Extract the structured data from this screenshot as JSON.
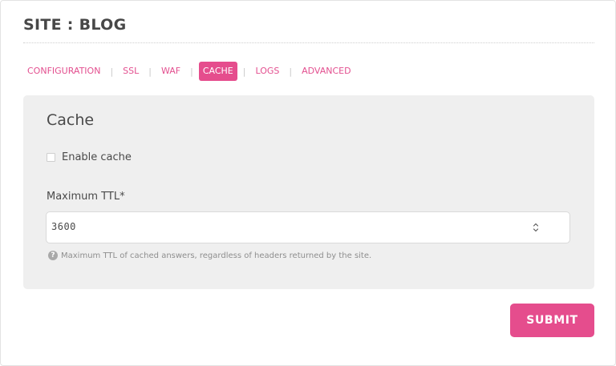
{
  "page": {
    "title": "SITE : BLOG"
  },
  "tabs": [
    {
      "label": "CONFIGURATION",
      "active": false
    },
    {
      "label": "SSL",
      "active": false
    },
    {
      "label": "WAF",
      "active": false
    },
    {
      "label": "CACHE",
      "active": true
    },
    {
      "label": "LOGS",
      "active": false
    },
    {
      "label": "ADVANCED",
      "active": false
    }
  ],
  "tab_separator": "|",
  "cache_panel": {
    "title": "Cache",
    "enable_cache": {
      "label": "Enable cache",
      "checked": false
    },
    "max_ttl": {
      "label": "Maximum TTL*",
      "value": "3600",
      "help": "Maximum TTL of cached answers, regardless of headers returned by the site."
    }
  },
  "actions": {
    "submit_label": "SUBMIT"
  },
  "colors": {
    "accent": "#e54d8d",
    "panel_bg": "#efefef",
    "text": "#4a4a4a",
    "muted": "#8e8e8e"
  },
  "icons": {
    "help": "question-circle-icon",
    "stepper": "chevron-up-down-icon"
  }
}
